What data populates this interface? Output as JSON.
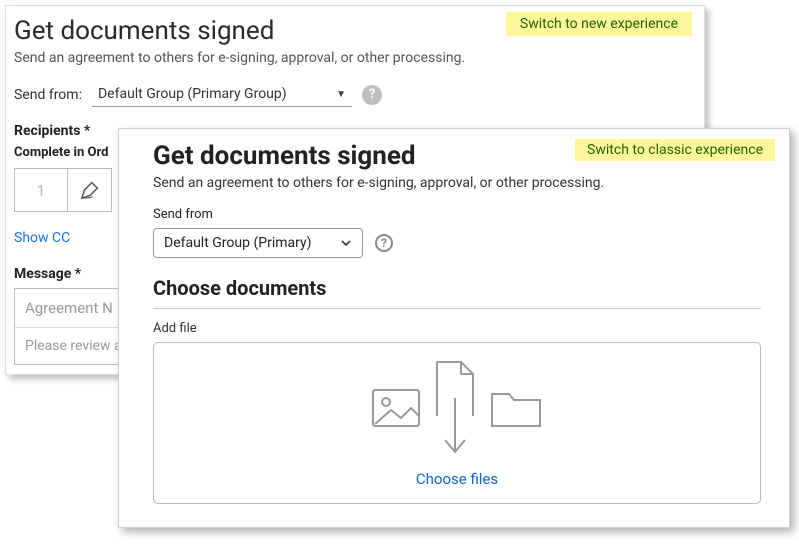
{
  "classic": {
    "title": "Get documents signed",
    "subtitle": "Send an agreement to others for e-signing, approval, or other processing.",
    "switch_link": "Switch to new experience",
    "send_from_label": "Send from:",
    "send_from_value": "Default Group (Primary Group)",
    "recipients_label": "Recipients *",
    "complete_order_label": "Complete in Ord",
    "order_value": "1",
    "show_cc": "Show CC",
    "message_label": "Message *",
    "agreement_name_placeholder": "Agreement N",
    "review_placeholder": "Please review a"
  },
  "modern": {
    "title": "Get documents signed",
    "subtitle": "Send an agreement to others for e-signing, approval, or other processing.",
    "switch_link": "Switch to classic experience",
    "send_from_label": "Send from",
    "send_from_value": "Default Group (Primary)",
    "choose_docs_title": "Choose documents",
    "add_file_label": "Add file",
    "choose_files": "Choose files"
  }
}
